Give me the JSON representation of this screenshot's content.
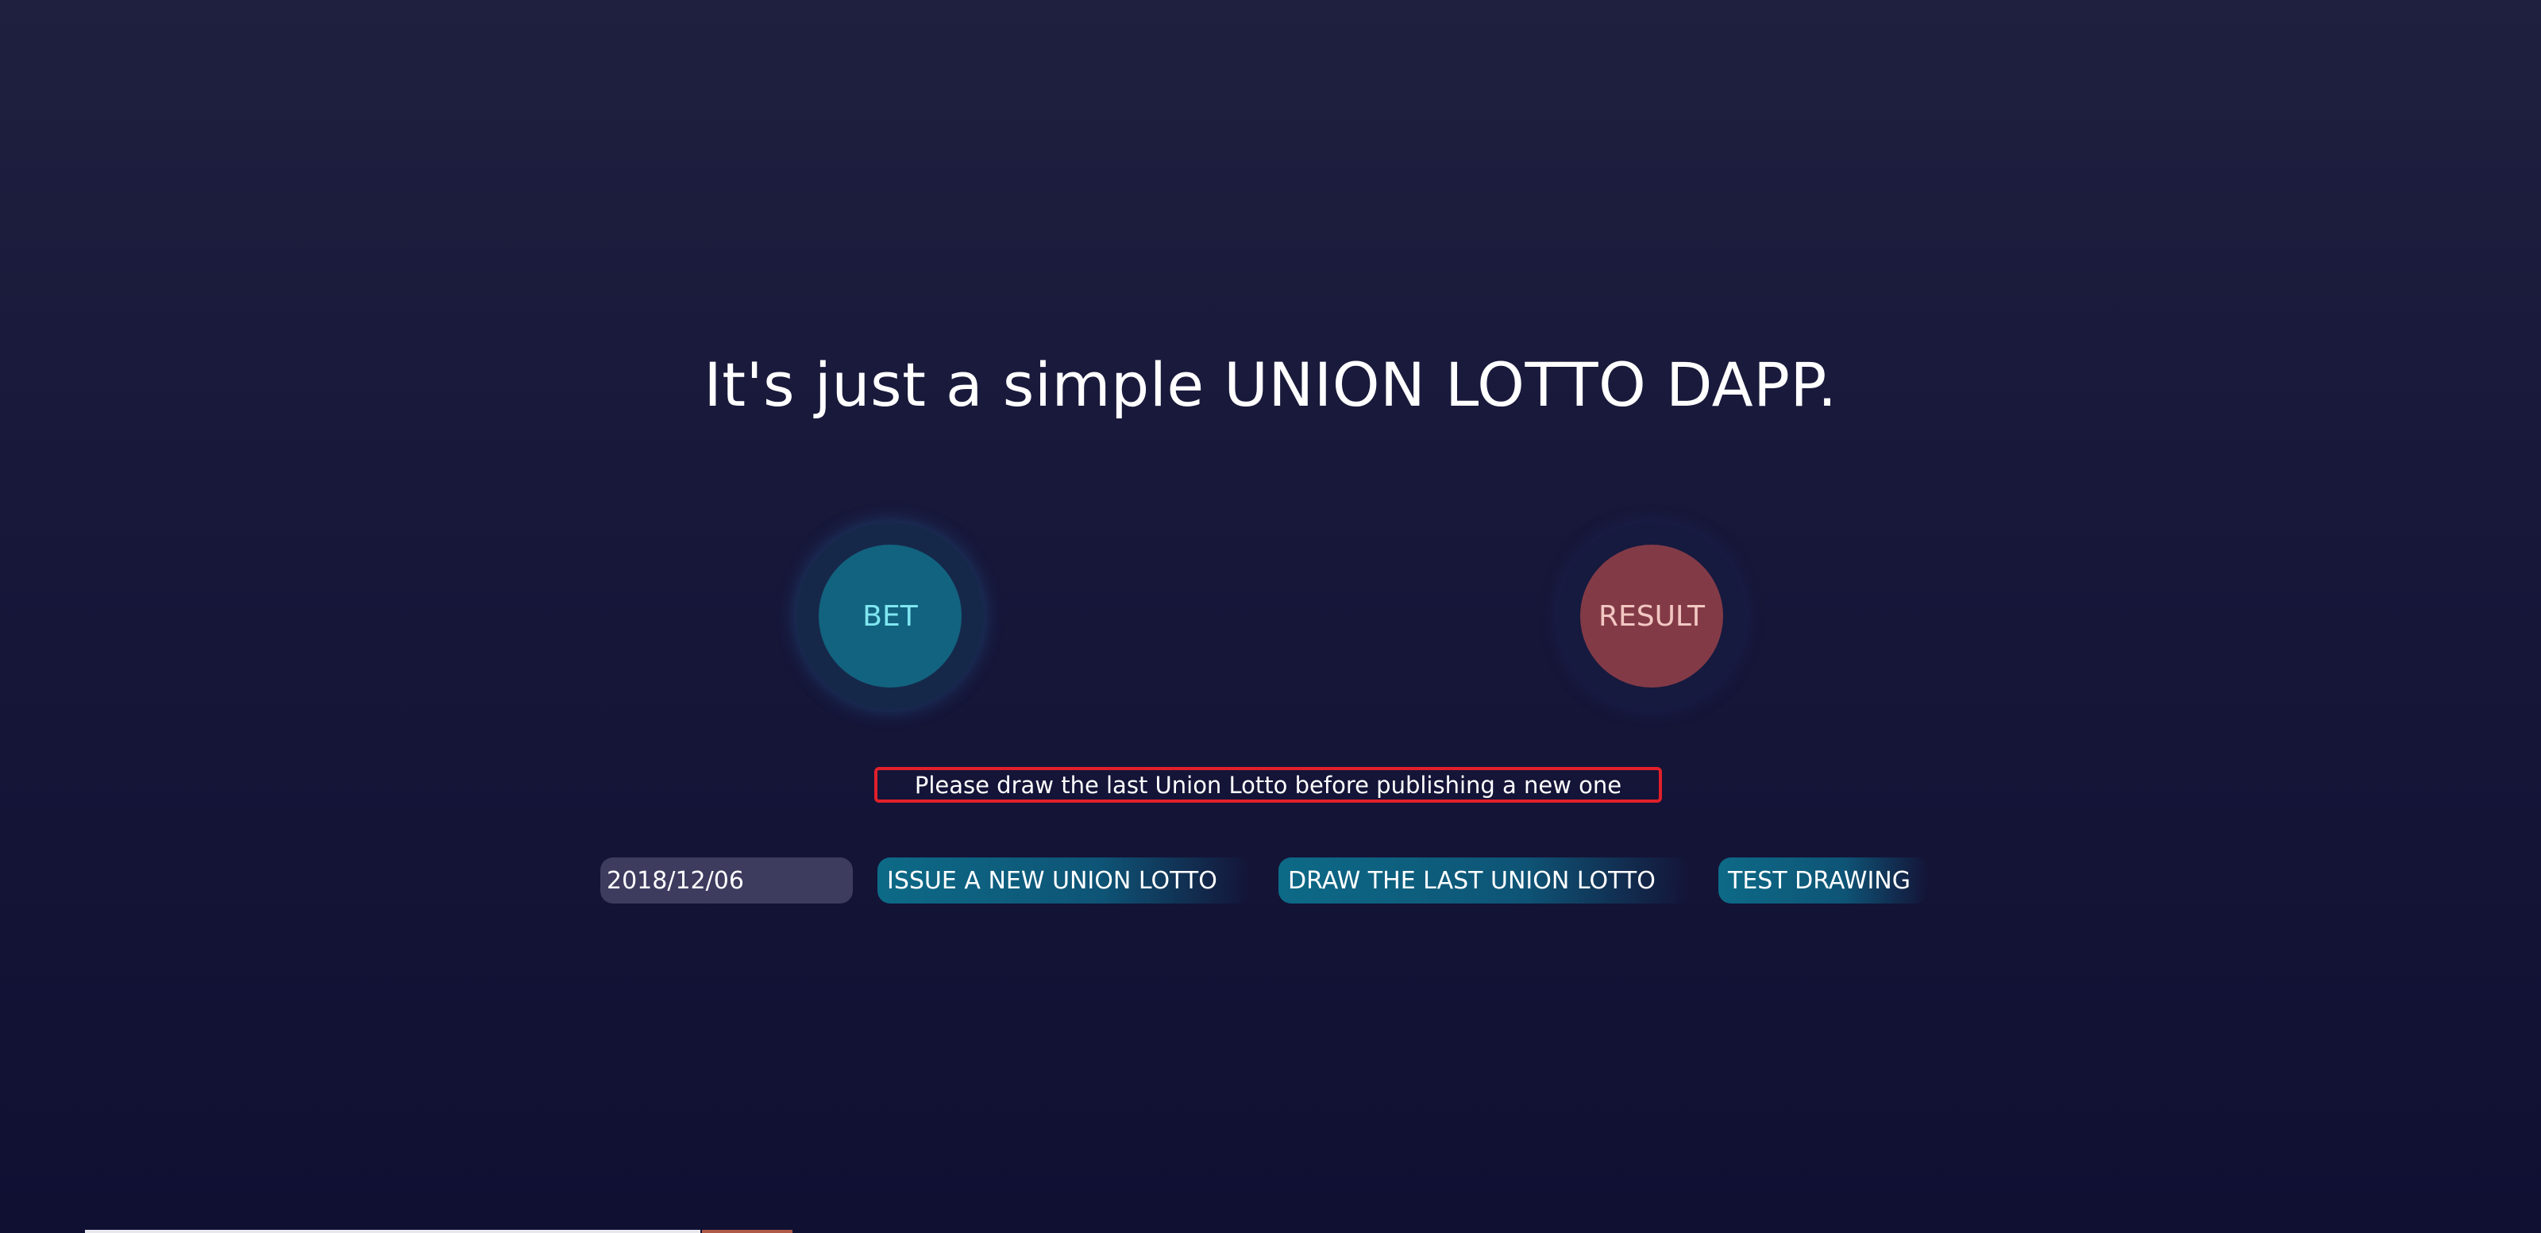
{
  "header": {
    "title": "It's just a simple UNION LOTTO DAPP."
  },
  "actions": {
    "bet_label": "BET",
    "result_label": "RESULT"
  },
  "notice": {
    "message": "Please draw the last Union Lotto before publishing a new one"
  },
  "controls": {
    "date_value": "2018/12/06",
    "issue_label": "ISSUE A NEW UNION LOTTO",
    "draw_label": "DRAW THE LAST UNION LOTTO",
    "test_label": "TEST DRAWING"
  },
  "colors": {
    "background_top": "#1f1f3f",
    "background_bottom": "#101033",
    "bet_fill": "#12637f",
    "bet_text": "#7fe6f0",
    "result_fill": "#833a47",
    "result_text": "#f2c7c2",
    "notice_border": "#e0202a",
    "button_fill": "#0d6a87",
    "input_fill": "#3d3c5f"
  }
}
